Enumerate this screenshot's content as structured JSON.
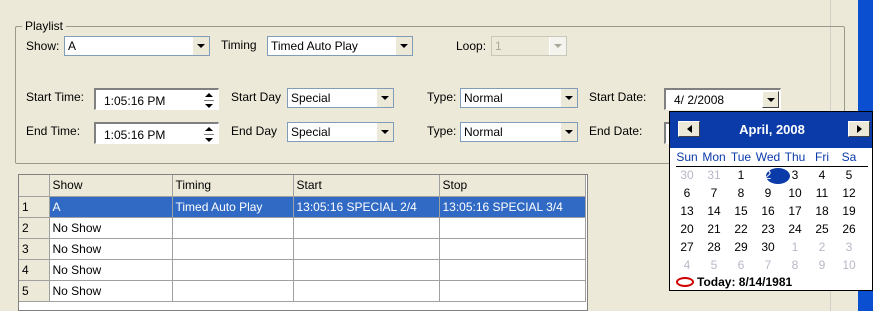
{
  "playlist": {
    "group_label": "Playlist",
    "show_label": "Show:",
    "show_value": "A",
    "timing_label": "Timing",
    "timing_value": "Timed Auto Play",
    "loop_label": "Loop:",
    "loop_value": "1",
    "start_time_label": "Start Time:",
    "start_time_value": "1:05:16 PM",
    "start_day_label": "Start Day",
    "start_day_value": "Special",
    "type_label_1": "Type:",
    "type_value_1": "Normal",
    "start_date_label": "Start Date:",
    "start_date_value": "4/ 2/2008",
    "end_time_label": "End Time:",
    "end_time_value": "1:05:16 PM",
    "end_day_label": "End Day",
    "end_day_value": "Special",
    "type_label_2": "Type:",
    "type_value_2": "Normal",
    "end_date_label": "End Date:"
  },
  "grid": {
    "headers": [
      "Show",
      "Timing",
      "Start",
      "Stop"
    ],
    "rows": [
      {
        "num": "1",
        "show": "A",
        "timing": "Timed Auto Play",
        "start": "13:05:16 SPECIAL 2/4",
        "stop": "13:05:16 SPECIAL 3/4"
      },
      {
        "num": "2",
        "show": "No Show",
        "timing": "",
        "start": "",
        "stop": ""
      },
      {
        "num": "3",
        "show": "No Show",
        "timing": "",
        "start": "",
        "stop": ""
      },
      {
        "num": "4",
        "show": "No Show",
        "timing": "",
        "start": "",
        "stop": ""
      },
      {
        "num": "5",
        "show": "No Show",
        "timing": "",
        "start": "",
        "stop": ""
      }
    ]
  },
  "calendar": {
    "title": "April, 2008",
    "dows": [
      "Sun",
      "Mon",
      "Tue",
      "Wed",
      "Thu",
      "Fri",
      "Sa"
    ],
    "weeks": [
      [
        "30",
        "31",
        "1",
        "2",
        "3",
        "4",
        "5"
      ],
      [
        "6",
        "7",
        "8",
        "9",
        "10",
        "11",
        "12"
      ],
      [
        "13",
        "14",
        "15",
        "16",
        "17",
        "18",
        "19"
      ],
      [
        "20",
        "21",
        "22",
        "23",
        "24",
        "25",
        "26"
      ],
      [
        "27",
        "28",
        "29",
        "30",
        "1",
        "2",
        "3"
      ],
      [
        "4",
        "5",
        "6",
        "7",
        "8",
        "9",
        "10"
      ]
    ],
    "selected_day": "2",
    "today_text": "Today: 8/14/1981"
  },
  "colors": {
    "selection": "#316ac5",
    "calendar_header": "#0a3ba8",
    "face": "#ece9d8"
  }
}
